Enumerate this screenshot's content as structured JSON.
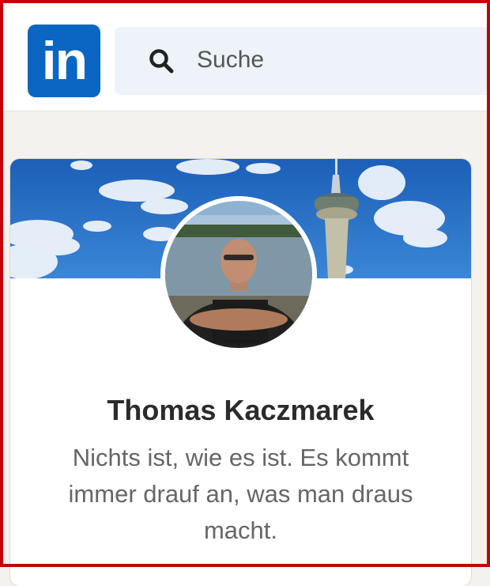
{
  "brand": {
    "logo_text": "in",
    "logo_color": "#0a66c2"
  },
  "search": {
    "placeholder": "Suche",
    "icon": "search-icon"
  },
  "profile": {
    "name": "Thomas Kaczmarek",
    "headline": "Nichts ist, wie es ist. Es kommt immer drauf an, was man draus macht."
  },
  "colors": {
    "frame": "#c40000",
    "background": "#f4f2ee",
    "search_bg": "#edf3f8"
  }
}
